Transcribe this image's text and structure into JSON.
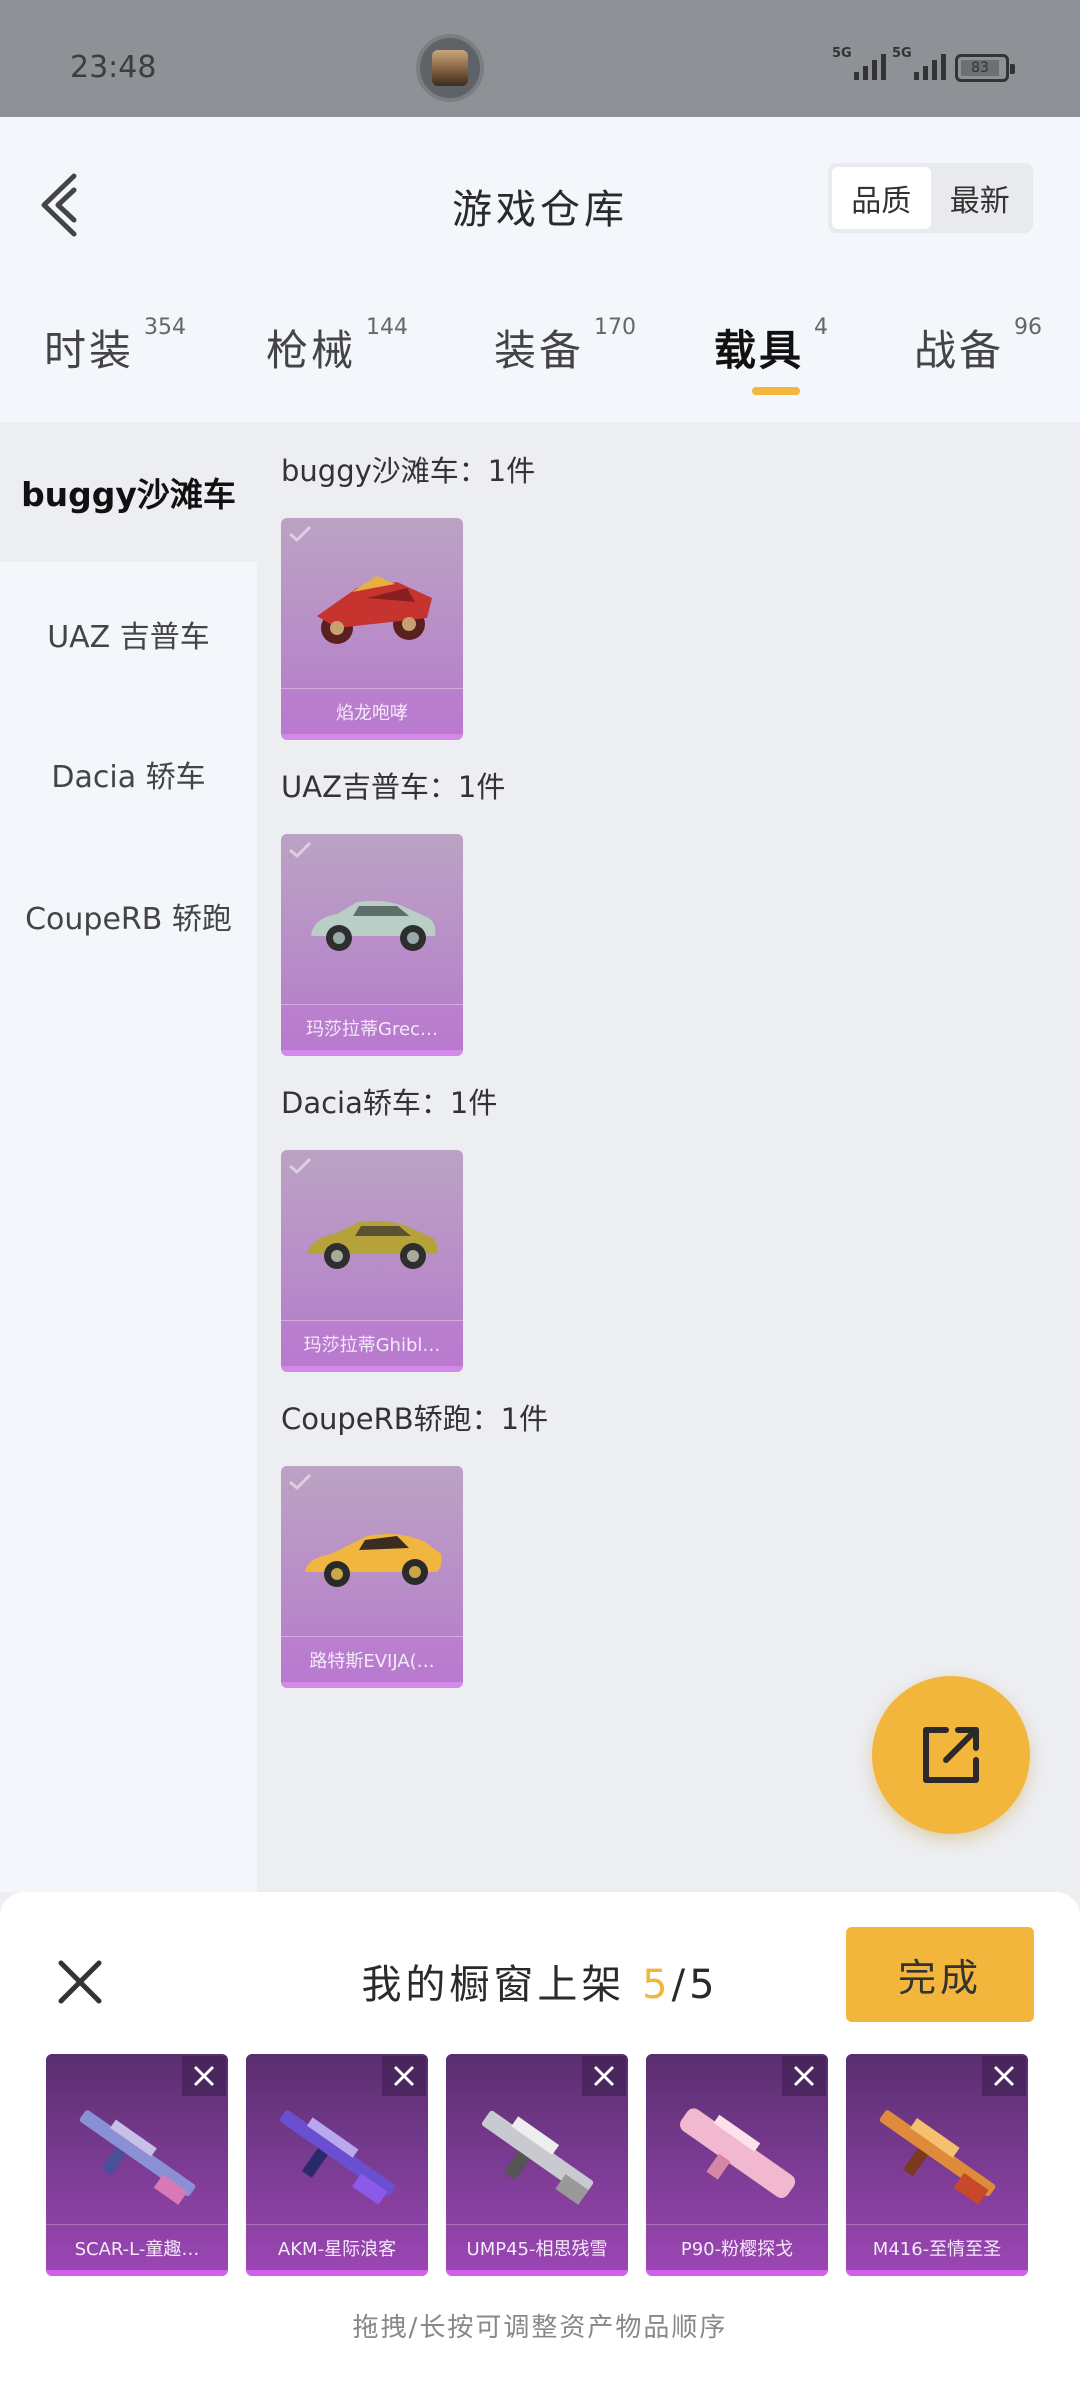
{
  "status_bar": {
    "time": "23:48",
    "signal_1": "5G",
    "signal_2": "5G",
    "battery": "83"
  },
  "header": {
    "title": "游戏仓库",
    "sort_options": [
      "品质",
      "最新"
    ],
    "active_sort": "品质"
  },
  "tabs": [
    {
      "label": "时装",
      "count": "354"
    },
    {
      "label": "枪械",
      "count": "144"
    },
    {
      "label": "装备",
      "count": "170"
    },
    {
      "label": "载具",
      "count": "4"
    },
    {
      "label": "战备",
      "count": "96"
    }
  ],
  "active_tab": "载具",
  "sidebar": {
    "items": [
      {
        "label": "buggy沙滩车"
      },
      {
        "label": "UAZ 吉普车"
      },
      {
        "label": "Dacia 轿车"
      },
      {
        "label": "CoupeRB 轿跑"
      }
    ]
  },
  "groups": [
    {
      "title": "buggy沙滩车：1件",
      "item_name": "焰龙咆哮"
    },
    {
      "title": "UAZ吉普车：1件",
      "item_name": "玛莎拉蒂Grec…"
    },
    {
      "title": "Dacia轿车：1件",
      "item_name": "玛莎拉蒂Ghibl…"
    },
    {
      "title": "CoupeRB轿跑：1件",
      "item_name": "路特斯EVIJA(…"
    }
  ],
  "showcase": {
    "title": "我的橱窗上架",
    "count_current": "5",
    "count_total": "/5",
    "done_label": "完成",
    "items": [
      {
        "name": "SCAR-L-童趣…"
      },
      {
        "name": "AKM-星际浪客"
      },
      {
        "name": "UMP45-相思残雪"
      },
      {
        "name": "P90-粉樱探戈"
      },
      {
        "name": "M416-至情至圣"
      }
    ],
    "hint": "拖拽/长按可调整资产物品顺序"
  },
  "colors": {
    "accent": "#f2b63c",
    "card_purple": "#b88bc8",
    "showcase_purple": "#7a3b92"
  },
  "icons": {
    "back": "back-chevron-icon",
    "share": "share-external-icon",
    "close": "close-icon",
    "remove": "remove-x-icon",
    "check": "check-icon"
  }
}
